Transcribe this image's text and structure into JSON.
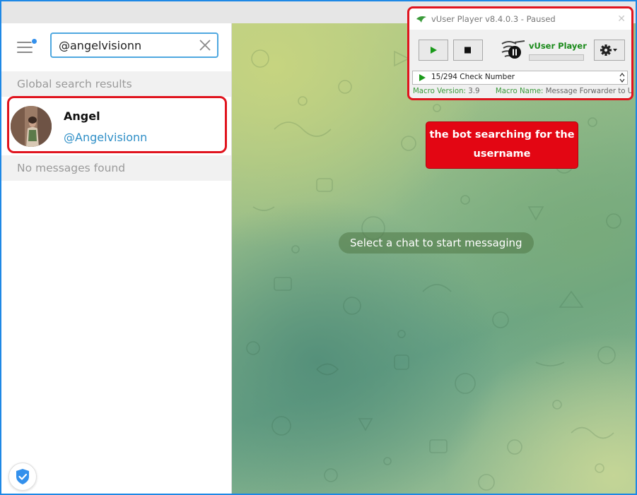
{
  "sidebar": {
    "search": {
      "value": "@angelvisionn",
      "placeholder": ""
    },
    "global_header": "Global search results",
    "result": {
      "name": "Angel",
      "username": "@Angelvisionn"
    },
    "messages_header": "No messages found"
  },
  "chat": {
    "empty_state": "Select a chat to start messaging"
  },
  "vuser_player": {
    "title": "vUser Player v8.4.0.3 - Paused",
    "logo_text": "vUser Player",
    "progress": 0,
    "list_item": "15/294 Check Number",
    "macro_version_label": "Macro Version:",
    "macro_version": "3.9",
    "macro_name_label": "Macro Name:",
    "macro_name": "Message Forwarder to User"
  },
  "callout": {
    "line1": "the bot searching for the",
    "line2": "username"
  },
  "colors": {
    "accent_blue": "#3390ec",
    "username_blue": "#2f8fc7",
    "highlight_red": "#e0141e",
    "vuser_green": "#1a8a1a"
  },
  "icons": [
    "menu-icon",
    "close-icon",
    "shield-check-icon",
    "play-icon",
    "stop-icon",
    "pause-icon",
    "gear-icon",
    "dropdown-arrow-icon",
    "app-logo-icon"
  ]
}
